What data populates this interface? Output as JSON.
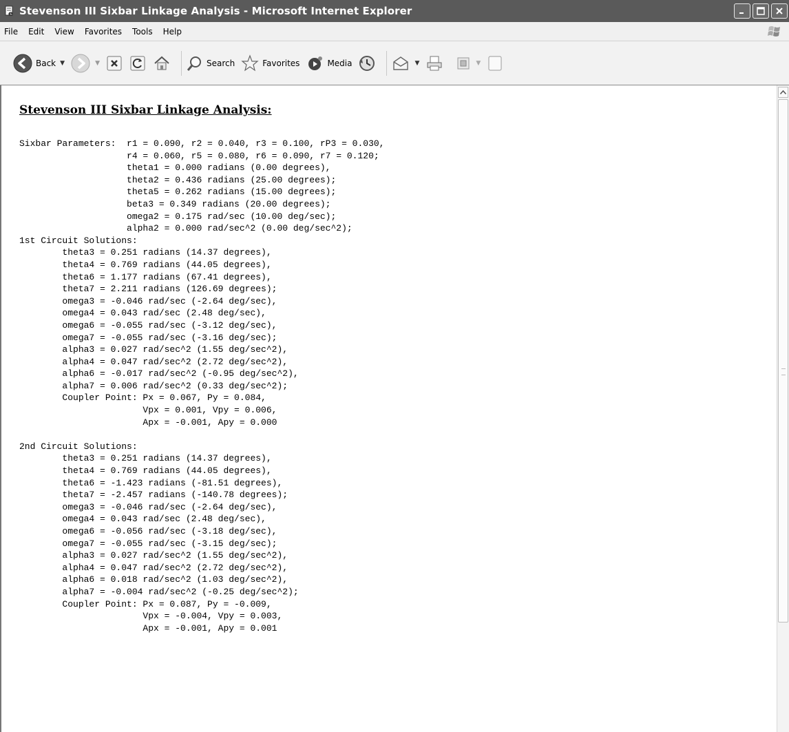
{
  "window": {
    "title": "Stevenson III Sixbar Linkage Analysis - Microsoft Internet Explorer",
    "minimize_label": "_",
    "maximize_label": "□",
    "close_label": "✕"
  },
  "menu": {
    "items": [
      "File",
      "Edit",
      "View",
      "Favorites",
      "Tools",
      "Help"
    ]
  },
  "toolbar": {
    "back_label": "Back",
    "search_label": "Search",
    "favorites_label": "Favorites",
    "media_label": "Media"
  },
  "page": {
    "title": "Stevenson III Sixbar Linkage Analysis:",
    "lines": [
      "Sixbar Parameters:  r1 = 0.090, r2 = 0.040, r3 = 0.100, rP3 = 0.030,",
      "                    r4 = 0.060, r5 = 0.080, r6 = 0.090, r7 = 0.120;",
      "                    theta1 = 0.000 radians (0.00 degrees),",
      "                    theta2 = 0.436 radians (25.00 degrees);",
      "                    theta5 = 0.262 radians (15.00 degrees);",
      "                    beta3 = 0.349 radians (20.00 degrees);",
      "                    omega2 = 0.175 rad/sec (10.00 deg/sec);",
      "                    alpha2 = 0.000 rad/sec^2 (0.00 deg/sec^2);",
      "1st Circuit Solutions:",
      "        theta3 = 0.251 radians (14.37 degrees),",
      "        theta4 = 0.769 radians (44.05 degrees),",
      "        theta6 = 1.177 radians (67.41 degrees),",
      "        theta7 = 2.211 radians (126.69 degrees);",
      "        omega3 = -0.046 rad/sec (-2.64 deg/sec),",
      "        omega4 = 0.043 rad/sec (2.48 deg/sec),",
      "        omega6 = -0.055 rad/sec (-3.12 deg/sec),",
      "        omega7 = -0.055 rad/sec (-3.16 deg/sec);",
      "        alpha3 = 0.027 rad/sec^2 (1.55 deg/sec^2),",
      "        alpha4 = 0.047 rad/sec^2 (2.72 deg/sec^2),",
      "        alpha6 = -0.017 rad/sec^2 (-0.95 deg/sec^2),",
      "        alpha7 = 0.006 rad/sec^2 (0.33 deg/sec^2);",
      "        Coupler Point: Px = 0.067, Py = 0.084,",
      "                       Vpx = 0.001, Vpy = 0.006,",
      "                       Apx = -0.001, Apy = 0.000",
      "",
      "2nd Circuit Solutions:",
      "        theta3 = 0.251 radians (14.37 degrees),",
      "        theta4 = 0.769 radians (44.05 degrees),",
      "        theta6 = -1.423 radians (-81.51 degrees),",
      "        theta7 = -2.457 radians (-140.78 degrees);",
      "        omega3 = -0.046 rad/sec (-2.64 deg/sec),",
      "        omega4 = 0.043 rad/sec (2.48 deg/sec),",
      "        omega6 = -0.056 rad/sec (-3.18 deg/sec),",
      "        omega7 = -0.055 rad/sec (-3.15 deg/sec);",
      "        alpha3 = 0.027 rad/sec^2 (1.55 deg/sec^2),",
      "        alpha4 = 0.047 rad/sec^2 (2.72 deg/sec^2),",
      "        alpha6 = 0.018 rad/sec^2 (1.03 deg/sec^2),",
      "        alpha7 = -0.004 rad/sec^2 (-0.25 deg/sec^2);",
      "        Coupler Point: Px = 0.087, Py = -0.009,",
      "                       Vpx = -0.004, Vpy = 0.003,",
      "                       Apx = -0.001, Apy = 0.001"
    ]
  }
}
